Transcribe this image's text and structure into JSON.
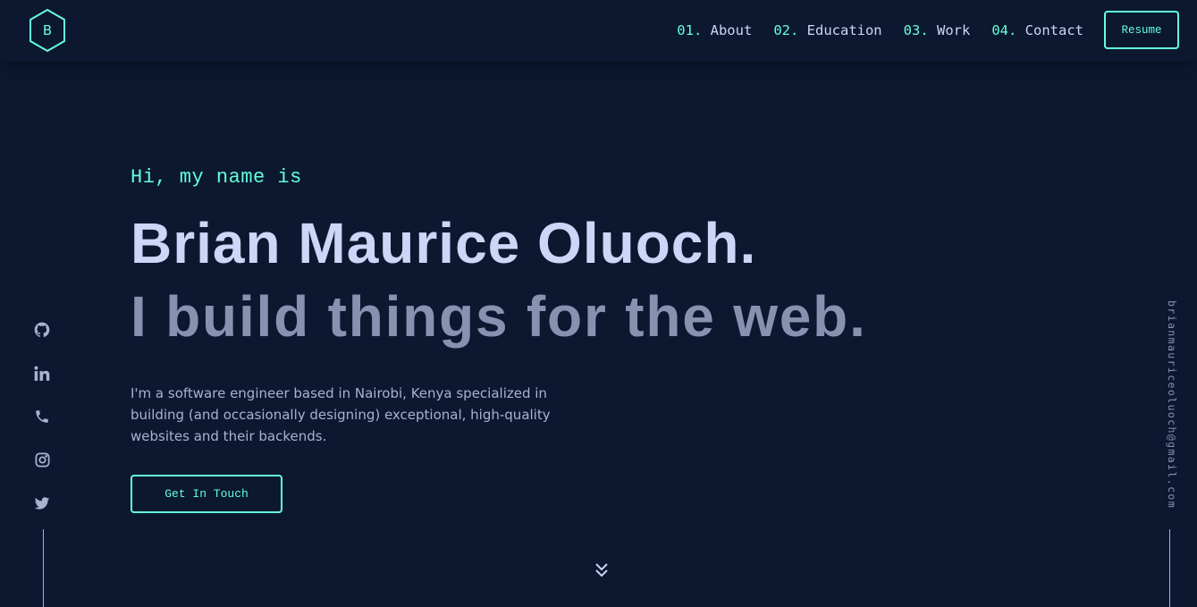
{
  "logo": {
    "letter": "B",
    "icon": "hexagon-logo-icon"
  },
  "nav": {
    "items": [
      {
        "num": "01.",
        "label": "About"
      },
      {
        "num": "02.",
        "label": "Education"
      },
      {
        "num": "03.",
        "label": "Work"
      },
      {
        "num": "04.",
        "label": "Contact"
      }
    ],
    "resume_label": "Resume"
  },
  "hero": {
    "greeting": "Hi, my name is",
    "name": "Brian Maurice Oluoch.",
    "tagline": "I build things for the web.",
    "bio": "I'm a software engineer based in Nairobi, Kenya specialized in building (and occasionally designing) exceptional, high-quality websites and their backends.",
    "cta_label": "Get In Touch"
  },
  "social": {
    "icons": [
      "github-icon",
      "linkedin-icon",
      "phone-icon",
      "instagram-icon",
      "twitter-icon"
    ]
  },
  "email": "brianmauriceoluoch@gmail.com",
  "colors": {
    "background": "#0b1830",
    "accent": "#64ffda",
    "heading": "#ccd6f6",
    "subheading": "#8892b0",
    "text": "#a8b2d1"
  }
}
